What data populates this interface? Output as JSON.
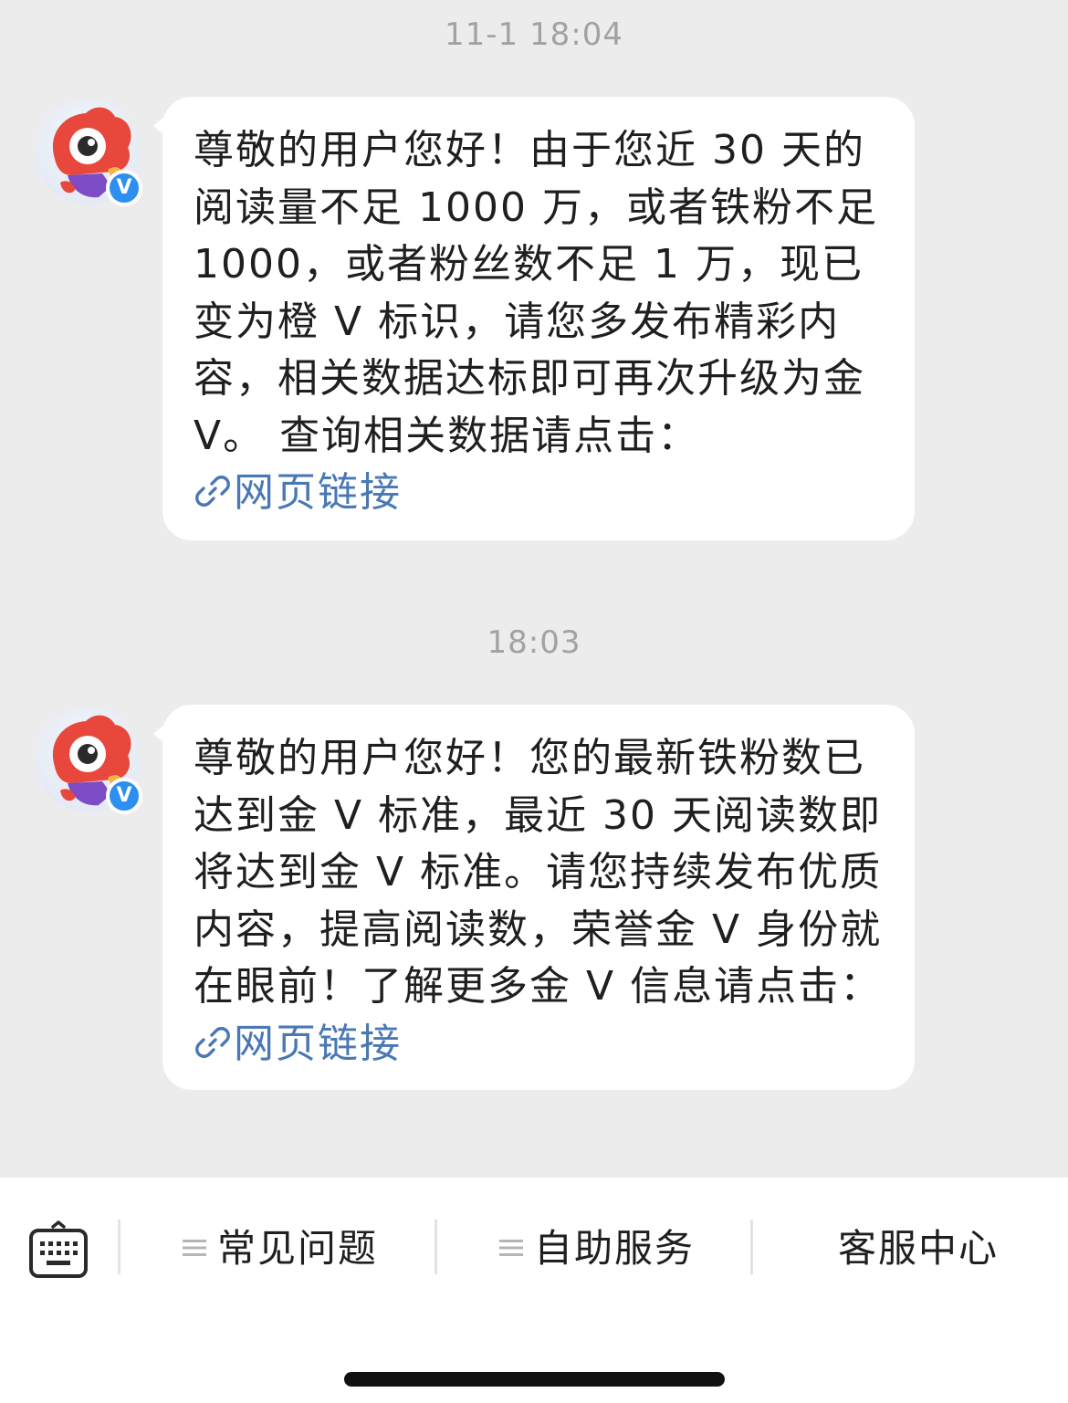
{
  "messages": [
    {
      "timestamp": "11-1 18:04",
      "text": "尊敬的用户您好！由于您近 30 天的阅读量不足 1000 万，或者铁粉不足 1000，或者粉丝数不足 1 万，现已变为橙 V 标识，请您多发布精彩内容，相关数据达标即可再次升级为金 V。 查询相关数据请点击：",
      "link_text": "网页链接"
    },
    {
      "timestamp": "18:03",
      "text": "尊敬的用户您好！您的最新铁粉数已达到金 V 标准，最近 30 天阅读数即将达到金 V 标准。请您持续发布优质内容，提高阅读数，荣誉金 V 身份就在眼前！了解更多金 V 信息请点击：",
      "link_text": "网页链接"
    }
  ],
  "avatar_badge": "V",
  "toolbar": {
    "items": [
      "常见问题",
      "自助服务",
      "客服中心"
    ]
  },
  "colors": {
    "background": "#ececec",
    "bubble": "#ffffff",
    "link": "#4a78b4",
    "badge": "#2d8ff0"
  }
}
